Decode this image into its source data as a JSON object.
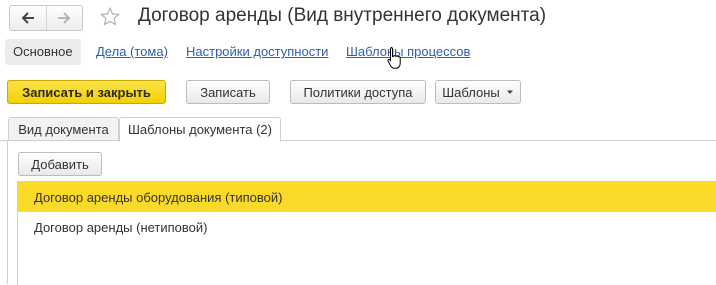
{
  "window": {
    "title": "Договор аренды (Вид внутреннего документа)"
  },
  "nav": {
    "back_icon": "arrow-left-icon",
    "forward_icon": "arrow-right-icon",
    "favorite_icon": "star-icon"
  },
  "sections": {
    "main": "Основное",
    "links": [
      "Дела (тома)",
      "Настройки доступности",
      "Шаблоны процессов"
    ]
  },
  "toolbar": {
    "save_close": "Записать и закрыть",
    "save": "Записать",
    "access_policies": "Политики доступа",
    "templates": "Шаблоны"
  },
  "tabs": [
    {
      "label": "Вид документа",
      "active": false
    },
    {
      "label": "Шаблоны документа (2)",
      "active": true
    }
  ],
  "panel": {
    "add_button": "Добавить",
    "rows": [
      {
        "text": "Договор аренды оборудования (типовой)",
        "selected": true
      },
      {
        "text": "Договор аренды (нетиповой)",
        "selected": false
      }
    ]
  },
  "colors": {
    "accent": "#f4d000",
    "selection": "#fada29",
    "link": "#2f5fa8"
  }
}
